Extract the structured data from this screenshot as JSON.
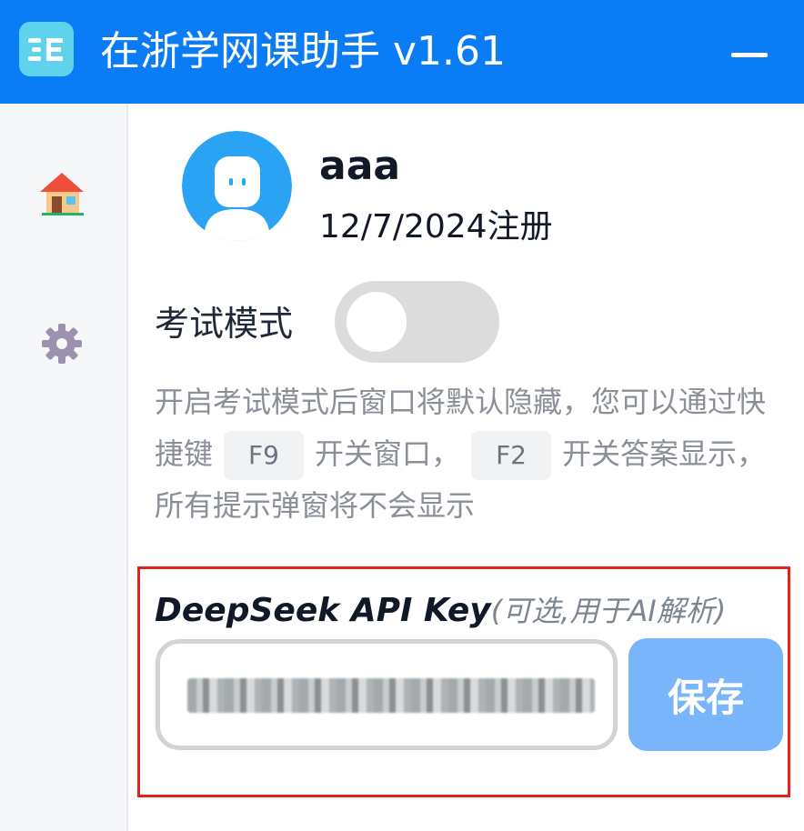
{
  "window": {
    "title": "在浙学网课助手 v1.61",
    "logo_icon": "app-logo-icon",
    "minimize_icon": "minimize-icon",
    "titlebar_color": "#0a7cf5"
  },
  "sidebar": {
    "items": [
      {
        "icon": "home-icon"
      },
      {
        "icon": "gear-icon"
      }
    ]
  },
  "profile": {
    "username": "aaa",
    "registered": "12/7/2024注册",
    "avatar_icon": "user-avatar-icon"
  },
  "exam_mode": {
    "label": "考试模式",
    "enabled": false,
    "hint_before": "开启考试模式后窗口将默认隐藏，您可以通过快捷键",
    "key1": "F9",
    "hint_mid": "开关窗口，",
    "key2": "F2",
    "hint_after": "开关答案显示，所有提示弹窗将不会显示"
  },
  "api_key": {
    "label_main": "DeepSeek API Key",
    "label_note": "(可选,用于AI解析)",
    "save_label": "保存",
    "save_color": "#78b5fa"
  }
}
